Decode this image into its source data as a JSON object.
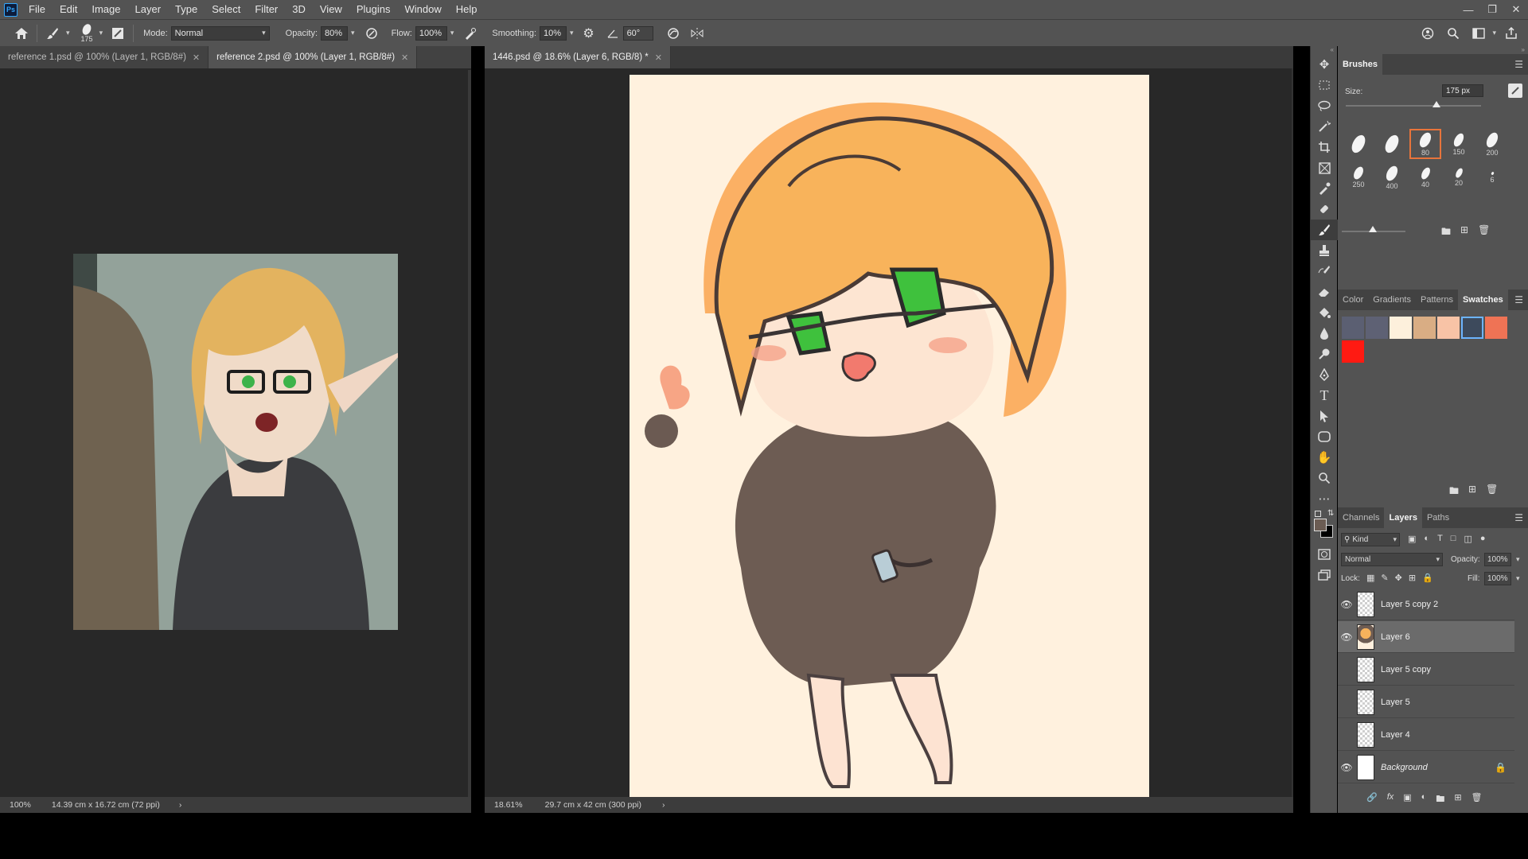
{
  "menubar": {
    "logo": "Ps",
    "items": [
      "File",
      "Edit",
      "Image",
      "Layer",
      "Type",
      "Select",
      "Filter",
      "3D",
      "View",
      "Plugins",
      "Window",
      "Help"
    ]
  },
  "options": {
    "brush_size": "175",
    "mode_label": "Mode:",
    "mode_value": "Normal",
    "opacity_label": "Opacity:",
    "opacity_value": "80%",
    "flow_label": "Flow:",
    "flow_value": "100%",
    "smoothing_label": "Smoothing:",
    "smoothing_value": "10%",
    "angle_value": "60°"
  },
  "left_doc": {
    "tabs": [
      {
        "label": "reference 1.psd @ 100% (Layer 1, RGB/8#)"
      },
      {
        "label": "reference 2.psd @ 100% (Layer 1, RGB/8#)"
      }
    ],
    "status_zoom": "100%",
    "status_info": "14.39 cm x 16.72 cm (72 ppi)"
  },
  "main_doc": {
    "tab_label": "1446.psd @ 18.6% (Layer 6, RGB/8) *",
    "status_zoom": "18.61%",
    "status_info": "29.7 cm x 42 cm (300 ppi)"
  },
  "brushes_panel": {
    "title": "Brushes",
    "size_label": "Size:",
    "size_value": "175 px",
    "presets": [
      "",
      "",
      "80",
      "150",
      "200",
      "250",
      "400",
      "40",
      "20",
      "6"
    ],
    "selected_index": 2
  },
  "swatches_panel": {
    "tabs": [
      "Color",
      "Gradients",
      "Patterns",
      "Swatches"
    ],
    "active_tab": "Swatches",
    "colors": [
      "#5b5f72",
      "#5e6174",
      "#fdf0dc",
      "#d9ad84",
      "#f8c3a6",
      "#3d4a5c",
      "#ef7355",
      "#ff1a12"
    ]
  },
  "layers_panel": {
    "tabs": [
      "Channels",
      "Layers",
      "Paths"
    ],
    "active_tab": "Layers",
    "filter_label": "Kind",
    "blend_mode": "Normal",
    "opacity_label": "Opacity:",
    "opacity_value": "100%",
    "lock_label": "Lock:",
    "fill_label": "Fill:",
    "fill_value": "100%",
    "layers": [
      {
        "name": "Layer 5 copy 2",
        "visible": true,
        "selected": false,
        "thumb": "checker"
      },
      {
        "name": "Layer 6",
        "visible": true,
        "selected": true,
        "thumb": "drawing"
      },
      {
        "name": "Layer 5 copy",
        "visible": false,
        "selected": false,
        "thumb": "checker"
      },
      {
        "name": "Layer 5",
        "visible": false,
        "selected": false,
        "thumb": "checker"
      },
      {
        "name": "Layer 4",
        "visible": false,
        "selected": false,
        "thumb": "checker"
      },
      {
        "name": "Background",
        "visible": true,
        "selected": false,
        "thumb": "white",
        "locked": true
      }
    ]
  }
}
